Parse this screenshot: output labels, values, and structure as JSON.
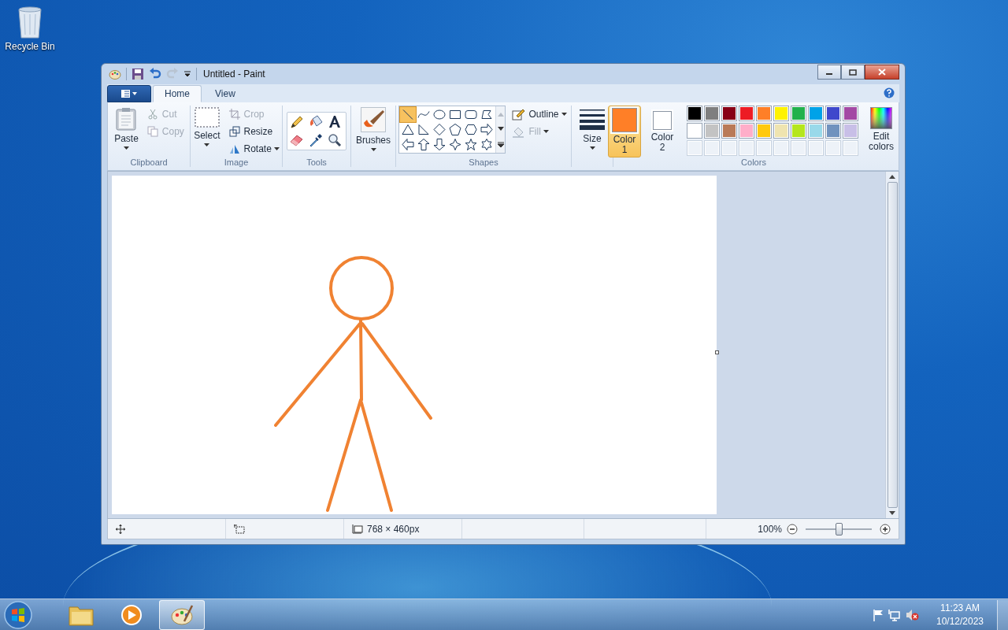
{
  "desktop": {
    "icons": [
      {
        "label": "Recycle Bin"
      }
    ]
  },
  "window": {
    "title": "Untitled - Paint"
  },
  "ribbon": {
    "tabs": [
      {
        "label": "Home",
        "selected": true
      },
      {
        "label": "View",
        "selected": false
      }
    ],
    "clipboard": {
      "title": "Clipboard",
      "paste": "Paste",
      "cut": {
        "label": "Cut",
        "disabled": true
      },
      "copy": {
        "label": "Copy",
        "disabled": true
      }
    },
    "image": {
      "title": "Image",
      "select": "Select",
      "crop": {
        "label": "Crop",
        "disabled": true
      },
      "resize": {
        "label": "Resize",
        "disabled": false
      },
      "rotate": {
        "label": "Rotate",
        "disabled": false
      }
    },
    "tools": {
      "title": "Tools"
    },
    "brushes": {
      "label": "Brushes"
    },
    "shapes": {
      "title": "Shapes",
      "items": [
        {
          "kind": "line",
          "selected": true
        },
        {
          "kind": "curve",
          "selected": false
        },
        {
          "kind": "oval",
          "selected": false
        },
        {
          "kind": "rectangle",
          "selected": false
        },
        {
          "kind": "rounded-rectangle",
          "selected": false
        },
        {
          "kind": "polygon",
          "selected": false
        },
        {
          "kind": "triangle",
          "selected": false
        },
        {
          "kind": "right-triangle",
          "selected": false
        },
        {
          "kind": "diamond",
          "selected": false
        },
        {
          "kind": "pentagon",
          "selected": false
        },
        {
          "kind": "hexagon",
          "selected": false
        },
        {
          "kind": "right-arrow",
          "selected": false
        },
        {
          "kind": "left-arrow",
          "selected": false
        },
        {
          "kind": "up-arrow",
          "selected": false
        },
        {
          "kind": "down-arrow",
          "selected": false
        },
        {
          "kind": "four-point-star",
          "selected": false
        },
        {
          "kind": "five-point-star",
          "selected": false
        },
        {
          "kind": "six-point-star",
          "selected": false
        }
      ],
      "outline": {
        "label": "Outline",
        "disabled": false
      },
      "fill": {
        "label": "Fill",
        "disabled": true
      }
    },
    "size": {
      "label": "Size"
    },
    "colors": {
      "title": "Colors",
      "color1": {
        "label": "Color 1",
        "color": "#ff7f27",
        "selected": true
      },
      "color2": {
        "label": "Color 2",
        "color": "#ffffff",
        "selected": false
      },
      "palette": [
        {
          "color": "#000000"
        },
        {
          "color": "#7f7f7f"
        },
        {
          "color": "#880015"
        },
        {
          "color": "#ed1c24"
        },
        {
          "color": "#ff7f27"
        },
        {
          "color": "#fff200"
        },
        {
          "color": "#22b14c"
        },
        {
          "color": "#00a2e8"
        },
        {
          "color": "#3f48cc"
        },
        {
          "color": "#a349a4"
        },
        {
          "color": "#ffffff"
        },
        {
          "color": "#c3c3c3"
        },
        {
          "color": "#b97a57"
        },
        {
          "color": "#ffaec9"
        },
        {
          "color": "#ffc90e"
        },
        {
          "color": "#efe4b0"
        },
        {
          "color": "#b5e61d"
        },
        {
          "color": "#99d9ea"
        },
        {
          "color": "#7092be"
        },
        {
          "color": "#c8bfe7"
        }
      ],
      "edit": "Edit colors"
    }
  },
  "status_bar": {
    "dimensions": "768 × 460px",
    "zoom": "100%",
    "zoom_slider": {
      "level": 0.5
    }
  },
  "taskbar": {
    "items": [
      {
        "kind": "explorer",
        "selected": false
      },
      {
        "kind": "media",
        "selected": false
      },
      {
        "kind": "paint",
        "selected": true
      }
    ],
    "time": "11:23 AM",
    "date": "10/12/2023"
  }
}
